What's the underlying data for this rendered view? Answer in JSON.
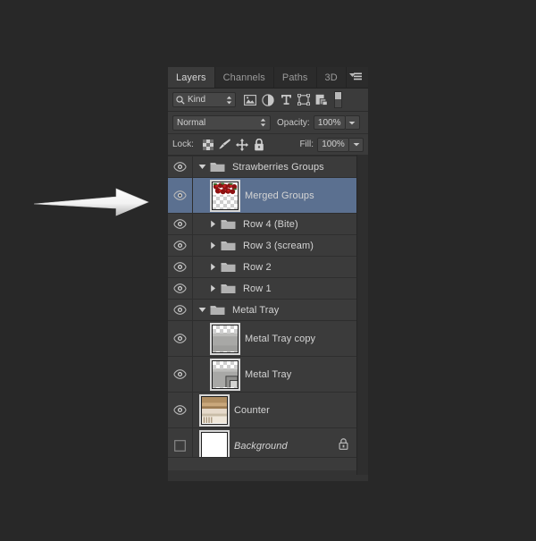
{
  "app": {
    "canvas_background": "#282828",
    "panel_background": "#3b3b3b",
    "selection_color": "#5b7090"
  },
  "annotation": {
    "arrow": "right-arrow-annotation",
    "points_to": "Merged Groups"
  },
  "panel": {
    "tabs": [
      {
        "label": "Layers",
        "active": true
      },
      {
        "label": "Channels",
        "active": false
      },
      {
        "label": "Paths",
        "active": false
      },
      {
        "label": "3D",
        "active": false
      }
    ],
    "menu_icon": "panel-menu-icon"
  },
  "filter_bar": {
    "search_icon": "search-icon",
    "kind_value": "Kind",
    "stepper_icon": "updown-stepper-icon",
    "icons": [
      {
        "name": "filter-pixel-layers-icon",
        "title": "image-icon"
      },
      {
        "name": "filter-adjustment-layers-icon",
        "title": "adjustment-circle-icon"
      },
      {
        "name": "filter-type-layers-icon",
        "title": "type-t-icon"
      },
      {
        "name": "filter-shape-layers-icon",
        "title": "shape-bounds-icon"
      },
      {
        "name": "filter-smart-objects-icon",
        "title": "smart-object-icon"
      }
    ],
    "toggle_name": "filter-enable-toggle"
  },
  "blend_bar": {
    "blend_mode": "Normal",
    "opacity_label": "Opacity:",
    "opacity_value": "100%",
    "stepper_icon": "updown-stepper-icon",
    "dropdown_icon": "chevron-down-icon"
  },
  "lock_bar": {
    "lock_label": "Lock:",
    "fill_label": "Fill:",
    "fill_value": "100%",
    "dropdown_icon": "chevron-down-icon",
    "lock_buttons": [
      {
        "name": "lock-transparent-pixels-icon"
      },
      {
        "name": "lock-image-pixels-brush-icon"
      },
      {
        "name": "lock-position-move-icon"
      },
      {
        "name": "lock-all-padlock-icon"
      }
    ]
  },
  "layers": [
    {
      "name": "Strawberries Groups",
      "type": "group",
      "expanded": true,
      "visible": true,
      "selected": false,
      "indent": 0,
      "locked": false
    },
    {
      "name": "Merged Groups",
      "type": "layer",
      "thumbnail": "strawberries-thumbnail",
      "visible": true,
      "selected": true,
      "indent": 1,
      "locked": false
    },
    {
      "name": "Row 4 (Bite)",
      "type": "group",
      "expanded": false,
      "visible": true,
      "selected": false,
      "indent": 1,
      "locked": false
    },
    {
      "name": "Row 3 (scream)",
      "type": "group",
      "expanded": false,
      "visible": true,
      "selected": false,
      "indent": 1,
      "locked": false
    },
    {
      "name": "Row 2",
      "type": "group",
      "expanded": false,
      "visible": true,
      "selected": false,
      "indent": 1,
      "locked": false
    },
    {
      "name": "Row 1",
      "type": "group",
      "expanded": false,
      "visible": true,
      "selected": false,
      "indent": 1,
      "locked": false
    },
    {
      "name": "Metal Tray",
      "type": "group",
      "expanded": true,
      "visible": true,
      "selected": false,
      "indent": 0,
      "locked": false
    },
    {
      "name": "Metal Tray copy",
      "type": "layer",
      "thumbnail": "metal-tray-thumbnail",
      "visible": true,
      "selected": false,
      "indent": 1,
      "locked": false
    },
    {
      "name": "Metal Tray",
      "type": "layer",
      "thumbnail": "metal-tray-mask-thumbnail",
      "visible": true,
      "selected": false,
      "indent": 1,
      "locked": false
    },
    {
      "name": "Counter",
      "type": "layer",
      "thumbnail": "counter-wood-thumbnail",
      "visible": true,
      "selected": false,
      "indent": 0,
      "locked": false
    },
    {
      "name": "Background",
      "type": "layer",
      "thumbnail": "white-background-thumbnail",
      "visible": false,
      "selected": false,
      "indent": 0,
      "locked": true,
      "italic": true
    }
  ]
}
